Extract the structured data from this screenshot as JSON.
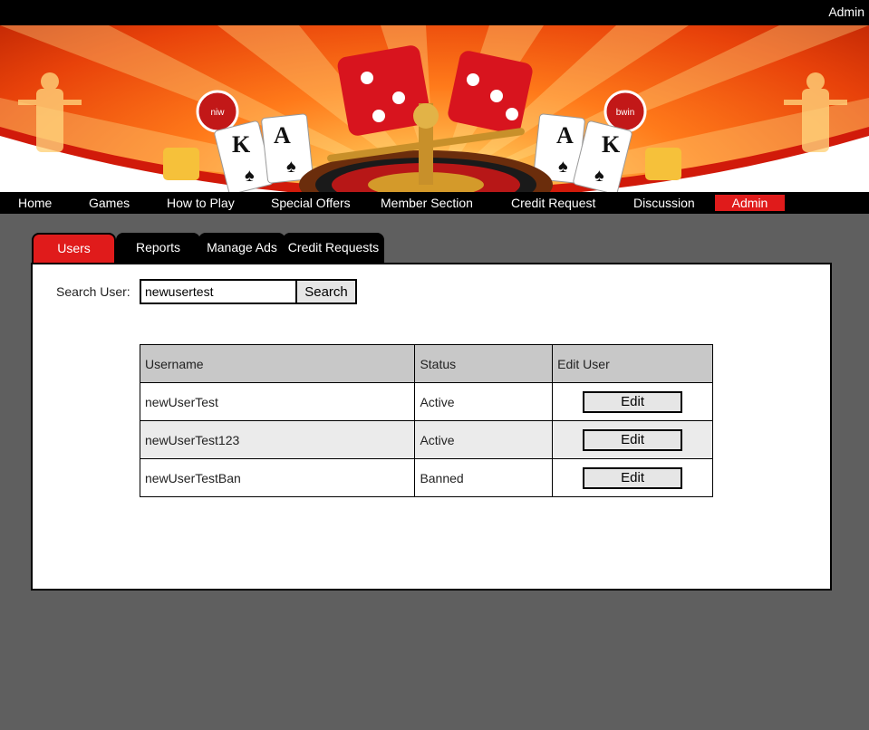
{
  "topbar": {
    "user_label": "Admin"
  },
  "nav": {
    "items": [
      {
        "label": "Home"
      },
      {
        "label": "Games"
      },
      {
        "label": "How to Play"
      },
      {
        "label": "Special Offers"
      },
      {
        "label": "Member Section"
      },
      {
        "label": "Credit Request"
      },
      {
        "label": "Discussion"
      },
      {
        "label": "Admin",
        "active": true
      }
    ]
  },
  "banner": {
    "chip_left": "niw",
    "chip_right": "bwin",
    "card_letters": [
      "K",
      "A",
      "A",
      "K"
    ]
  },
  "tabs": [
    {
      "label": "Users",
      "active": true
    },
    {
      "label": "Reports"
    },
    {
      "label": "Manage Ads"
    },
    {
      "label": "Credit Requests"
    }
  ],
  "search": {
    "label": "Search User:",
    "value": "newusertest",
    "button_label": "Search"
  },
  "table": {
    "headers": [
      "Username",
      "Status",
      "Edit User"
    ],
    "rows": [
      {
        "username": "newUserTest",
        "status": "Active",
        "action": "Edit"
      },
      {
        "username": "newUserTest123",
        "status": "Active",
        "action": "Edit"
      },
      {
        "username": "newUserTestBan",
        "status": "Banned",
        "action": "Edit"
      }
    ]
  },
  "colors": {
    "accent": "#e01b1b",
    "nav_bg": "#000000",
    "page_bg": "#5f5f5f",
    "header_row": "#c8c8c8"
  }
}
